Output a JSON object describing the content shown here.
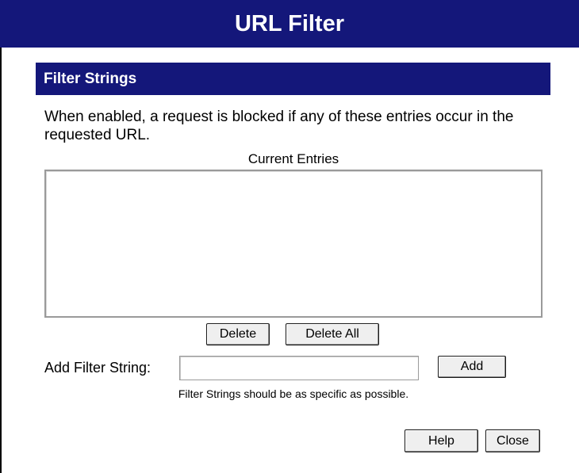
{
  "header": {
    "title": "URL Filter"
  },
  "section": {
    "title": "Filter Strings"
  },
  "description": "When enabled, a request is blocked if any of these entries occur in the requested URL.",
  "entries": {
    "label": "Current Entries",
    "items": []
  },
  "buttons": {
    "delete": "Delete",
    "delete_all": "Delete All",
    "add": "Add",
    "help": "Help",
    "close": "Close"
  },
  "add_filter": {
    "label": "Add Filter String:",
    "value": ""
  },
  "hint": "Filter Strings should be as specific as possible.",
  "colors": {
    "banner": "#14177a",
    "page": "#ffffff"
  }
}
